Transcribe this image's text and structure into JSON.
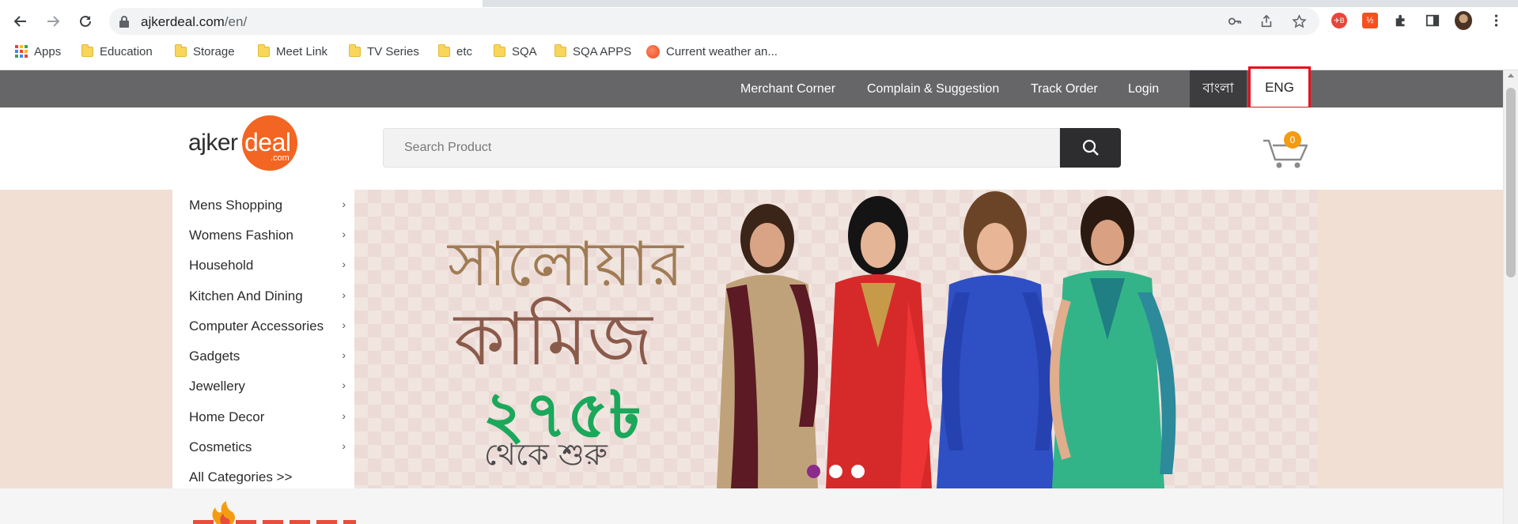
{
  "browser": {
    "url_host": "ajkerdeal.com",
    "url_path": "/en/",
    "toolbar_icons": [
      "back-icon",
      "forward-icon",
      "reload-icon",
      "lock-icon",
      "key-icon",
      "share-icon",
      "star-icon"
    ],
    "extension_icons": [
      "extension-red-icon",
      "extension-orange-icon",
      "puzzle-icon",
      "sidepanel-icon",
      "profile-avatar",
      "menu-kebab-icon"
    ],
    "bookmarks": [
      {
        "label": "Apps",
        "icon": "apps-grid-icon"
      },
      {
        "label": "Education",
        "icon": "folder-icon"
      },
      {
        "label": "Storage",
        "icon": "folder-icon"
      },
      {
        "label": "Meet Link",
        "icon": "folder-icon"
      },
      {
        "label": "TV Series",
        "icon": "folder-icon"
      },
      {
        "label": "etc",
        "icon": "folder-icon"
      },
      {
        "label": "SQA",
        "icon": "folder-icon"
      },
      {
        "label": "SQA APPS",
        "icon": "folder-icon"
      },
      {
        "label": "Current weather an...",
        "icon": "weather-icon"
      }
    ]
  },
  "topbar": {
    "links": [
      "Merchant Corner",
      "Complain & Suggestion",
      "Track Order",
      "Login"
    ],
    "lang_bangla": "বাংলা",
    "lang_english": "ENG",
    "highlight_color": "#e3121b"
  },
  "header": {
    "logo_ajker": "ajker",
    "logo_deal": "deal",
    "logo_com": ".com",
    "search_placeholder": "Search Product",
    "cart_count": "0",
    "brand_color": "#f26522"
  },
  "categories": [
    "Mens Shopping",
    "Womens Fashion",
    "Household",
    "Kitchen And Dining",
    "Computer Accessories",
    "Gadgets",
    "Jewellery",
    "Home Decor",
    "Cosmetics",
    "All Categories >>"
  ],
  "banner": {
    "line1": "সালোয়ার",
    "line2": "কামিজ",
    "price": "২৭৫৳",
    "from": "থেকে শুরু",
    "slide_count": 3,
    "active_slide": 1
  }
}
